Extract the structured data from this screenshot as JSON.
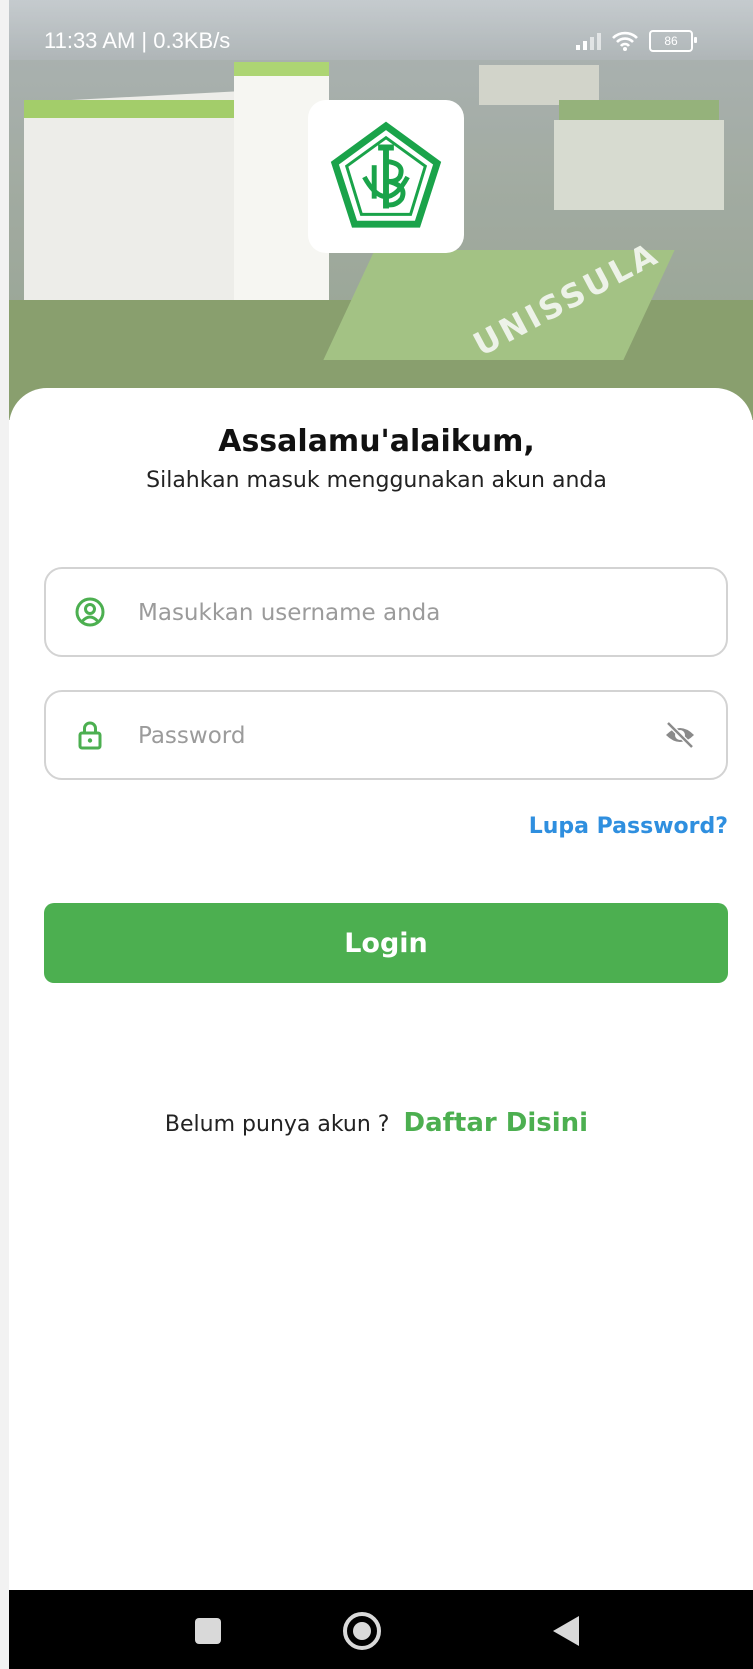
{
  "status_bar": {
    "time_speed": "11:33 AM | 0.3KB/s",
    "battery": "86"
  },
  "hero": {
    "building_text": "UNISSULA",
    "logo_icon": "unissula-logo"
  },
  "greeting": {
    "title": "Assalamu'alaikum,",
    "subtitle": "Silahkan masuk menggunakan akun anda"
  },
  "form": {
    "username_placeholder": "Masukkan username anda",
    "username_value": "",
    "username_icon": "user-circle-icon",
    "password_placeholder": "Password",
    "password_value": "",
    "password_icon": "lock-icon",
    "visibility_icon": "eye-off-icon",
    "forgot_label": "Lupa Password?",
    "login_label": "Login"
  },
  "register": {
    "question": "Belum punya akun ?",
    "link_label": "Daftar Disini"
  },
  "nav": {
    "recents_icon": "square-icon",
    "home_icon": "circle-icon",
    "back_icon": "triangle-back-icon"
  },
  "colors": {
    "primary_green": "#4caf50",
    "link_blue": "#2f8fdf",
    "border_gray": "#d3d3d3"
  }
}
